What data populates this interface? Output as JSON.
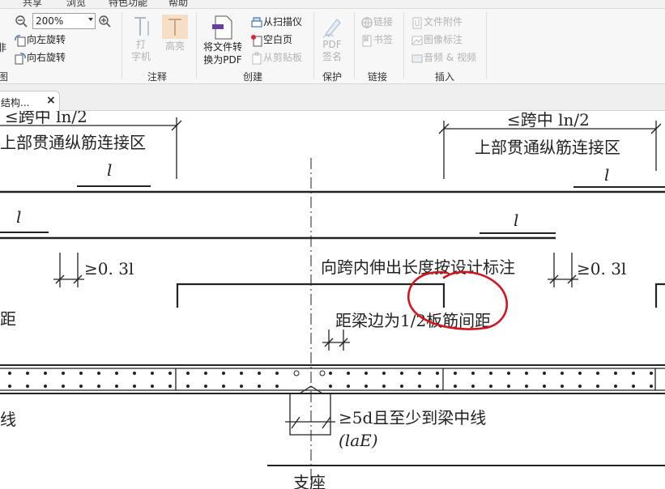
{
  "menubar": {
    "tabs": [
      "共享",
      "浏览",
      "特色功能",
      "帮助"
    ]
  },
  "ribbon": {
    "zoom": {
      "value": "200%"
    },
    "view_buttons": {
      "rotate_left": "向左旋转",
      "rotate_right": "向右旋转",
      "partial_left": "图"
    },
    "annot_buttons": {
      "typewriter": "打\n字机",
      "highlight": "高亮"
    },
    "create_buttons": {
      "convert": "将文件转\n换为PDF",
      "from_scanner": "从扫描仪",
      "blank_page": "空白页",
      "from_clipboard": "从剪贴板"
    },
    "protect_buttons": {
      "sign": "PDF\n签名"
    },
    "link_buttons": {
      "link": "链接",
      "bookmark": "书签"
    },
    "insert_buttons": {
      "file_attachment": "文件附件",
      "image_annotation": "图像标注",
      "audio_video": "音频 & 视频"
    },
    "group_labels": {
      "annotate": "注释",
      "create": "创建",
      "protect": "保护",
      "link": "链接",
      "insert": "插入"
    },
    "partial_labels": {
      "left_edge": "非"
    }
  },
  "tabs": {
    "doc_tab": {
      "label": "结构...",
      "close": "×"
    }
  },
  "drawing": {
    "top_left_label": "≤跨中 ln/2",
    "top_right_label": "≤跨中 ln/2",
    "splice_zone_left": "上部贯通纵筋连接区",
    "splice_zone_right": "上部贯通纵筋连接区",
    "l_symbol": "l",
    "l_subscript": "l",
    "dim_03_left": "≥0. 3l",
    "dim_03_right": "≥0. 3l",
    "extend_note": "向跨内伸出长度按设计标注",
    "distance_note": "距梁边为1/2板筋间距",
    "left_cut_text": "距",
    "left_cut_text2": "线",
    "anchor_note": "≥5d且至少到梁中线",
    "lae_label": "(laE)",
    "bottom_label": "支座"
  },
  "colors": {
    "annotation_red": "#d4141c",
    "ribbon_bg": "#f7f7f7",
    "line": "#222222"
  }
}
